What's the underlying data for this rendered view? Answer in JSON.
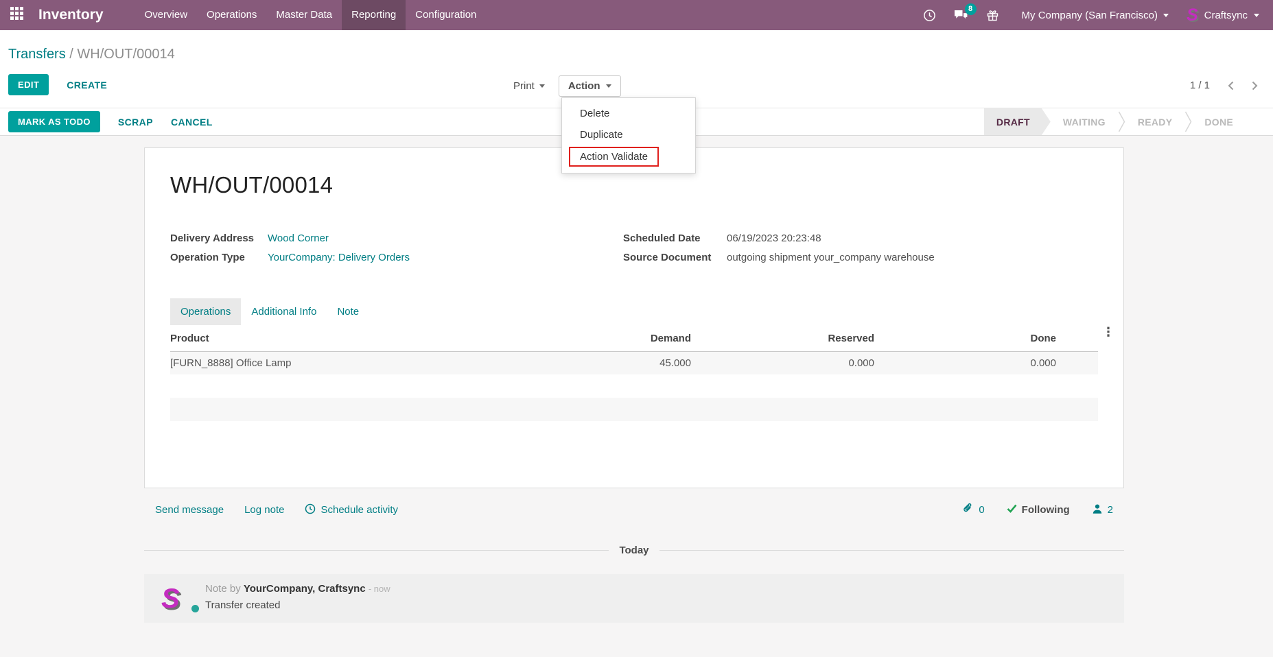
{
  "colors": {
    "nav_bg": "#875A7B",
    "nav_active_bg": "#6d4a63",
    "primary_teal": "#00A09D",
    "link_teal": "#017E84",
    "highlight_red": "#e0201d",
    "stage_active_text": "#552944",
    "following_check_green": "#21a353",
    "avatar_magenta": "#c42cc0"
  },
  "icons": {
    "apps": "3x3-grid",
    "activities": "clock",
    "messages": "chat-bubbles",
    "gift": "gift-box",
    "caret": "triangle-down",
    "pager_prev": "chevron-left",
    "pager_next": "chevron-right",
    "kebab": "⋮",
    "schedule_clock": "clock-outline",
    "paperclip": "paperclip",
    "check": "checkmark",
    "person": "user-silhouette"
  },
  "nav": {
    "brand": "Inventory",
    "items": [
      {
        "label": "Overview"
      },
      {
        "label": "Operations"
      },
      {
        "label": "Master Data"
      },
      {
        "label": "Reporting"
      },
      {
        "label": "Configuration"
      }
    ],
    "messages_badge": "8",
    "company_switcher": "My Company (San Francisco)",
    "user_name": "Craftsync",
    "avatar_letter": "S"
  },
  "control_panel": {
    "breadcrumb_parent": "Transfers",
    "breadcrumb_separator": "/",
    "breadcrumb_current": "WH/OUT/00014",
    "edit_label": "EDIT",
    "create_label": "CREATE",
    "print_label": "Print",
    "action_label": "Action",
    "pager_value": "1 / 1"
  },
  "action_menu": {
    "items": [
      {
        "label": "Delete"
      },
      {
        "label": "Duplicate"
      },
      {
        "label": "Action Validate"
      }
    ],
    "highlighted_item": "Action Validate"
  },
  "statusbar": {
    "mark_as_todo": "MARK AS TODO",
    "scrap": "SCRAP",
    "cancel": "CANCEL",
    "stages": [
      {
        "label": "DRAFT"
      },
      {
        "label": "WAITING"
      },
      {
        "label": "READY"
      },
      {
        "label": "DONE"
      }
    ],
    "active_stage": "DRAFT"
  },
  "form": {
    "title": "WH/OUT/00014",
    "delivery_address_label": "Delivery Address",
    "delivery_address_value": "Wood Corner",
    "operation_type_label": "Operation Type",
    "operation_type_value": "YourCompany: Delivery Orders",
    "scheduled_date_label": "Scheduled Date",
    "scheduled_date_value": "06/19/2023 20:23:48",
    "source_document_label": "Source Document",
    "source_document_value": "outgoing shipment your_company warehouse",
    "tabs": [
      {
        "label": "Operations"
      },
      {
        "label": "Additional Info"
      },
      {
        "label": "Note"
      }
    ],
    "active_tab": "Operations",
    "table": {
      "columns": [
        {
          "label": "Product"
        },
        {
          "label": "Demand"
        },
        {
          "label": "Reserved"
        },
        {
          "label": "Done"
        }
      ],
      "rows": [
        {
          "product": "[FURN_8888] Office Lamp",
          "demand": "45.000",
          "reserved": "0.000",
          "done": "0.000"
        }
      ]
    }
  },
  "chatter": {
    "send_message": "Send message",
    "log_note": "Log note",
    "schedule_activity": "Schedule activity",
    "attachment_count": "0",
    "following_label": "Following",
    "follower_count": "2",
    "date_divider": "Today",
    "message": {
      "prefix": "Note by",
      "author": "YourCompany, Craftsync",
      "time": "- now",
      "body": "Transfer created",
      "avatar_letter": "S"
    }
  }
}
